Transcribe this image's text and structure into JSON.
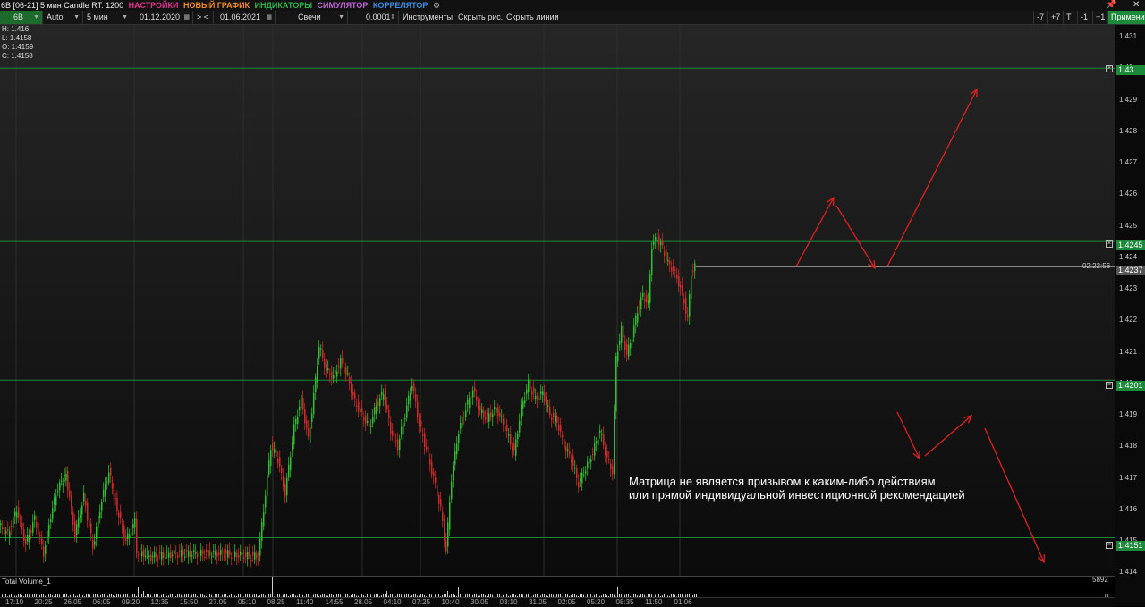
{
  "titlebar": {
    "title": "6B [06-21] 5 мин Candle RT: 1200",
    "menu": [
      {
        "label": "НАСТРОЙКИ",
        "color": "#e0338c"
      },
      {
        "label": "НОВЫЙ ГРАФИК",
        "color": "#f08a24"
      },
      {
        "label": "ИНДИКАТОРЫ",
        "color": "#2fb34b"
      },
      {
        "label": "СИМУЛЯТОР",
        "color": "#c064d6"
      },
      {
        "label": "КОРРЕЛЯТОР",
        "color": "#3a8fe8"
      }
    ],
    "gear_icon": "gears-icon",
    "pin_icon": "pin-icon",
    "close_icon": "close-icon"
  },
  "toolbar": {
    "symbol": "6B",
    "scale": "Auto",
    "timeframe": "5 мин",
    "date_from": "01.12.2020",
    "date_nav": "> <",
    "date_to": "01.06.2021",
    "chart_type": "Свечи",
    "tick": "0.0001",
    "instruments": "Инструменты",
    "hide_drawings": "Скрыть рис.",
    "hide_lines": "Скрыть линии",
    "btn_minus7": "-7",
    "btn_plus7": "+7",
    "btn_t": "T",
    "btn_minus1": "-1",
    "btn_plus1": "+1",
    "apply": "Применить"
  },
  "ohlc": {
    "h": "H: 1.416",
    "l": "L: 1.4158",
    "o": "O: 1.4159",
    "c": "C: 1.4158"
  },
  "price_axis": [
    "1.431",
    "1.43",
    "1.429",
    "1.428",
    "1.427",
    "1.426",
    "1.425",
    "1.424",
    "1.423",
    "1.422",
    "1.421",
    "1.42",
    "1.419",
    "1.418",
    "1.417",
    "1.416",
    "1.415",
    "1.414"
  ],
  "levels": [
    "1.43",
    "1.4245",
    "1.4201",
    "1.4151"
  ],
  "current_price": "1.4237",
  "timer": "02:22:56",
  "volume": {
    "label": "Total Volume_1",
    "max": "5892",
    "zero": "0"
  },
  "time_axis": [
    "17:10",
    "20:25",
    "26.05",
    "06:05",
    "09:20",
    "12:35",
    "15:50",
    "27.05",
    "05:10",
    "08:25",
    "11:40",
    "14:55",
    "28.05",
    "04:10",
    "07:25",
    "10:40",
    "30.05",
    "03:10",
    "31.05",
    "02:05",
    "05:20",
    "08:35",
    "11:50",
    "01.06"
  ],
  "disclaimer": {
    "line1": "Матрица не является призывом к каким-либо действиям",
    "line2": "или прямой индивидуальной инвестиционной рекомендацией"
  },
  "colors": {
    "bull": "#2fbf2f",
    "bear": "#d02a2a",
    "level_line": "#1c8a3a",
    "arrow": "#e02020"
  }
}
